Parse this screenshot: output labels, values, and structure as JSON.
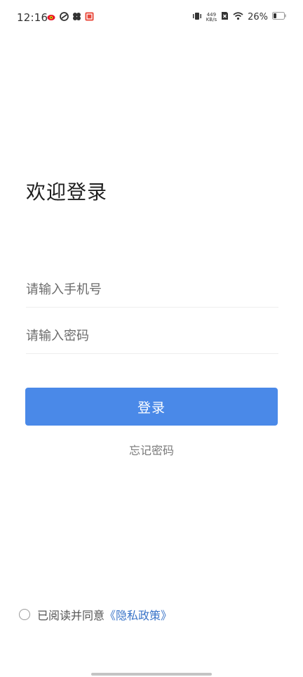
{
  "status_bar": {
    "time": "12:16",
    "notification_icons": [
      "weibo-icon",
      "app-swirl-icon",
      "app-clover-icon",
      "app-red-badge-icon"
    ],
    "net_speed_value": "449",
    "net_speed_unit": "KB/s",
    "battery_percent": "26%"
  },
  "login": {
    "title": "欢迎登录",
    "phone_placeholder": "请输入手机号",
    "password_placeholder": "请输入密码",
    "login_button": "登录",
    "forgot_password": "忘记密码"
  },
  "agreement": {
    "prefix": "已阅读并同意",
    "policy_link": "《隐私政策》"
  },
  "colors": {
    "primary": "#4a89e8",
    "link": "#3a74c8"
  }
}
